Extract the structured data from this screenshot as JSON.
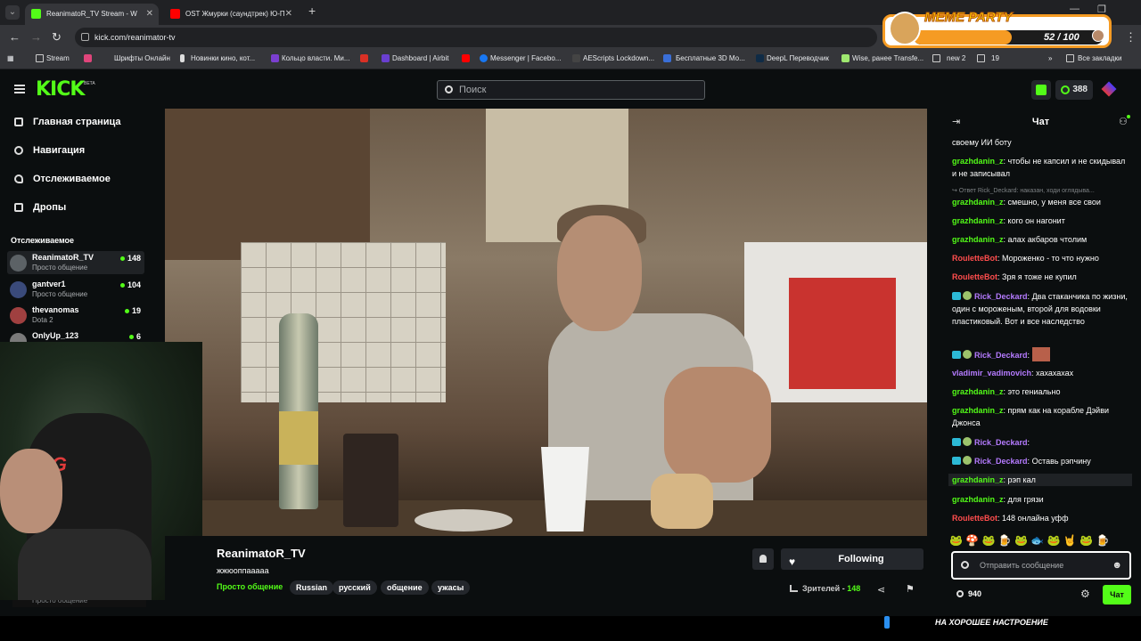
{
  "browser": {
    "tabs": [
      {
        "title": "ReanimatoR_TV Stream - W",
        "active": true,
        "color": "#53fc18"
      },
      {
        "title": "OST Жмурки (саундтрек) Ю-П",
        "active": false,
        "color": "#ff0000"
      }
    ],
    "new_tab": "+",
    "url": "kick.com/reanimator-tv",
    "bookmarks": [
      {
        "label": "Stream",
        "icon": "folder-icon"
      },
      {
        "label": "Шрифты Онлайн",
        "icon": "font-icon"
      },
      {
        "label": "Новинки кино, кот...",
        "icon": "film-icon"
      },
      {
        "label": "Кольцо власти. Ми...",
        "icon": "r-icon"
      },
      {
        "label": "",
        "icon": "gmail-icon"
      },
      {
        "label": "Dashboard | Airbit",
        "icon": "airbit-icon"
      },
      {
        "label": "",
        "icon": "youtube-icon"
      },
      {
        "label": "Messenger | Facebo...",
        "icon": "facebook-icon"
      },
      {
        "label": "AEScripts Lockdown...",
        "icon": "aescripts-icon"
      },
      {
        "label": "Бесплатные 3D Мо...",
        "icon": "3d-icon"
      },
      {
        "label": "DeepL Переводчик",
        "icon": "deepl-icon"
      },
      {
        "label": "Wise, ранее Transfe...",
        "icon": "wise-icon"
      },
      {
        "label": "new 2",
        "icon": "folder-icon"
      },
      {
        "label": "19",
        "icon": "folder-icon"
      },
      {
        "label": "»",
        "icon": ""
      },
      {
        "label": "Все закладки",
        "icon": "folder-icon"
      }
    ]
  },
  "meme_party": {
    "title": "MEME PARTY",
    "count": "52 / 100",
    "progress_percent": 52,
    "accent": "#f59b23"
  },
  "kick": {
    "logo": "KICK",
    "beta": "BETA",
    "search_placeholder": "Поиск",
    "kicks_count": "388",
    "accent": "#53fc18"
  },
  "sidebar": {
    "nav": [
      {
        "label": "Главная страница",
        "icon": "home-icon"
      },
      {
        "label": "Навигация",
        "icon": "compass-icon"
      },
      {
        "label": "Отслеживаемое",
        "icon": "heart-icon"
      },
      {
        "label": "Дропы",
        "icon": "gift-icon"
      }
    ],
    "followed_title": "Отслеживаемое",
    "channels": [
      {
        "name": "ReanimatoR_TV",
        "category": "Просто общение",
        "viewers": "148",
        "active": true
      },
      {
        "name": "gantver1",
        "category": "Просто общение",
        "viewers": "104",
        "active": false
      },
      {
        "name": "thevanomas",
        "category": "Dota 2",
        "viewers": "19",
        "active": false
      },
      {
        "name": "OnlyUp_123",
        "category": "",
        "viewers": "6",
        "active": false
      }
    ],
    "collapsed_category": "Просто общение"
  },
  "webcam": {
    "chair_logo": "RG"
  },
  "stream": {
    "streamer": "ReanimatoR_TV",
    "title": "жжюоппааааа",
    "category": "Просто общение",
    "tags": [
      "Russian",
      "русский",
      "общение",
      "ужасы"
    ],
    "follow_label": "Following",
    "viewers_label": "Зрителей -",
    "viewers_count": "148"
  },
  "chat": {
    "title": "Чат",
    "messages": [
      {
        "user": "",
        "text": "своему ИИ боту",
        "color": "#ffffff"
      },
      {
        "user": "grazhdanin_z",
        "text": "чтобы не капсил и не скидывал и не записывал",
        "color": "#53fc18"
      },
      {
        "user": "",
        "text": "↪ Ответ Rick_Deckard: наказан, ходи оглядыва...",
        "color": "#7d8184",
        "reply": true
      },
      {
        "user": "grazhdanin_z",
        "text": "смешно, у меня все свои",
        "color": "#53fc18"
      },
      {
        "user": "grazhdanin_z",
        "text": "кого он нагонит",
        "color": "#53fc18"
      },
      {
        "user": "grazhdanin_z",
        "text": "алах акбаров чтолим",
        "color": "#53fc18"
      },
      {
        "user": "RouletteBot",
        "text": "Мороженко - то что нужно",
        "color": "#ff4d4d"
      },
      {
        "user": "RouletteBot",
        "text": "Зря я тоже не купил",
        "color": "#ff4d4d"
      },
      {
        "user": "Rick_Deckard",
        "text": "Два стаканчика по жизни, один с мороженым, второй для водовки пластиковый. Вот и все наследство",
        "color": "#b57bff",
        "badges": true
      },
      {
        "user": "Rick_Deckard",
        "text": "",
        "color": "#b57bff",
        "badges": true,
        "emote": true
      },
      {
        "user": "vladimir_vadimovich",
        "text": "хахахахах",
        "color": "#b57bff"
      },
      {
        "user": "grazhdanin_z",
        "text": "это гениально",
        "color": "#53fc18"
      },
      {
        "user": "grazhdanin_z",
        "text": "прям как на корабле Дэйви Джонса",
        "color": "#53fc18"
      },
      {
        "user": "Rick_Deckard",
        "text": "",
        "color": "#b57bff",
        "badges": true
      },
      {
        "user": "Rick_Deckard",
        "text": "Оставь рэпчину",
        "color": "#b57bff",
        "badges": true
      },
      {
        "user": "grazhdanin_z",
        "text": "рэп кал",
        "color": "#53fc18",
        "highlight": true
      },
      {
        "user": "grazhdanin_z",
        "text": "для грязи",
        "color": "#53fc18"
      },
      {
        "user": "RouletteBot",
        "text": "148 онлайна уфф",
        "color": "#ff4d4d"
      }
    ],
    "emotes": "🐸 🍄 🐸 🍺 🐸 🐟 🐸 🤘 🐸 🍺",
    "input_placeholder": "Отправить сообщение",
    "points": "940",
    "send_label": "Чат"
  },
  "overlay_text": "НА ХОРОШЕЕ НАСТРОЕНИЕ"
}
